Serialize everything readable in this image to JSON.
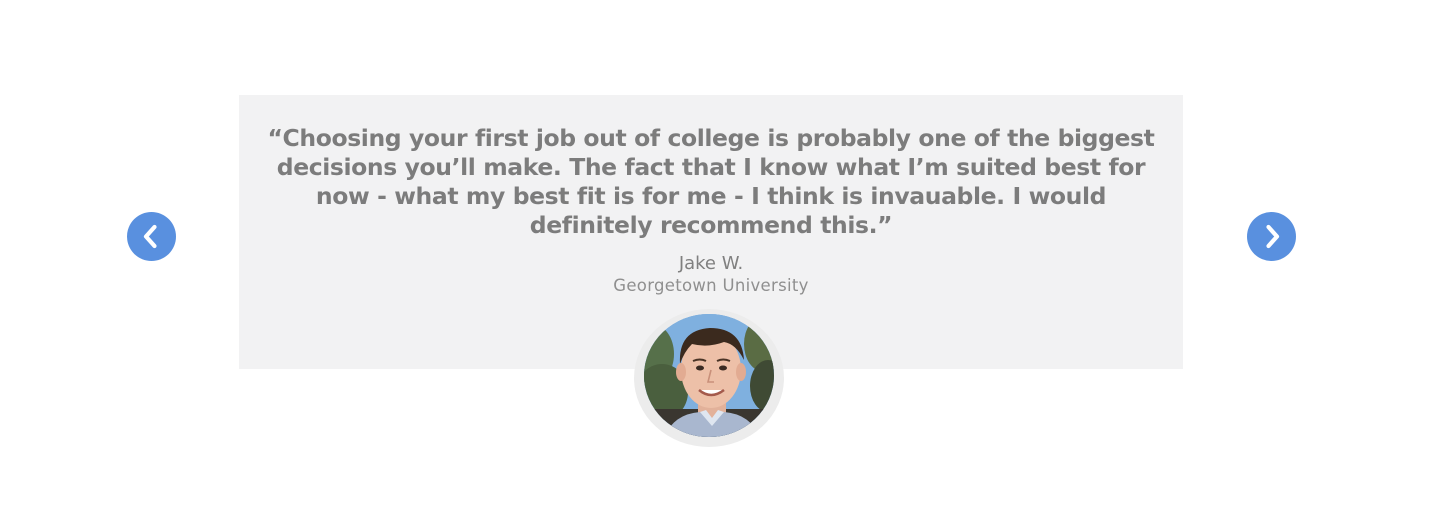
{
  "testimonial": {
    "quote": "“Choosing your first job out of college is probably one of the biggest decisions you’ll make. The fact that I know what I’m suited best for now - what my best fit is for me - I think is invauable. I would definitely recommend this.”",
    "author_name": "Jake W.",
    "author_school": "Georgetown University"
  },
  "navigation": {
    "previous_icon": "chevron-left-icon",
    "next_icon": "chevron-right-icon"
  },
  "colors": {
    "card_background": "#f2f2f3",
    "quote_text": "#7c7c7c",
    "arrow_button": "#5990df",
    "avatar_ring": "#ececec"
  }
}
